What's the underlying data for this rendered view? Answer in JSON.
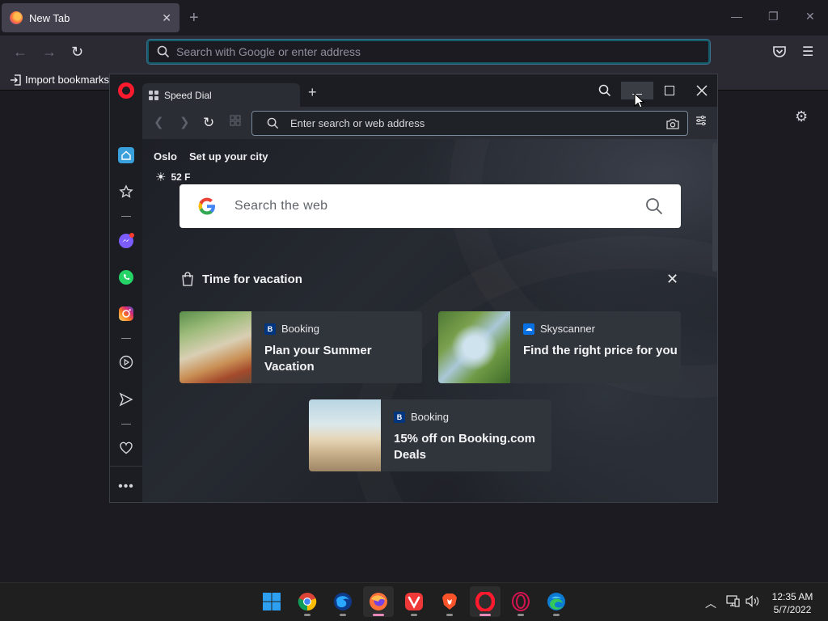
{
  "firefox": {
    "tab_title": "New Tab",
    "tab_close": "✕",
    "new_tab": "+",
    "url_placeholder": "Search with Google or enter address",
    "import_bookmarks": "Import bookmarks..."
  },
  "opera": {
    "tab_title": "Speed Dial",
    "new_tab": "+",
    "address_placeholder": "Enter search or web address",
    "weather": {
      "city": "Oslo",
      "setup": "Set up your city",
      "temp": "52 F"
    },
    "google_search_placeholder": "Search the web",
    "vacation": {
      "title": "Time for vacation",
      "cards": [
        {
          "brand": "Booking",
          "headline": "Plan your Summer Vacation"
        },
        {
          "brand": "Skyscanner",
          "headline": "Find the right price for you"
        },
        {
          "brand": "Booking",
          "headline": "15% off on Booking.com Deals"
        }
      ]
    }
  },
  "taskbar": {
    "time": "12:35 AM",
    "date": "5/7/2022"
  },
  "colors": {
    "opera_red": "#ff1b2d",
    "booking_blue": "#003580",
    "skyscanner_blue": "#0770e3"
  }
}
